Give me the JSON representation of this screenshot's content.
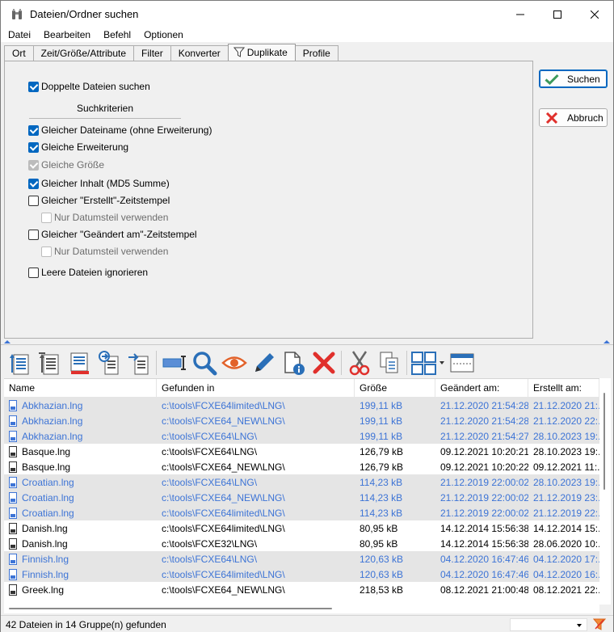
{
  "window": {
    "title": "Dateien/Ordner suchen"
  },
  "menu": [
    "Datei",
    "Bearbeiten",
    "Befehl",
    "Optionen"
  ],
  "tabs": [
    "Ort",
    "Zeit/Größe/Attribute",
    "Filter",
    "Konverter",
    "Duplikate",
    "Profile"
  ],
  "duplicates": {
    "find_duplicates": {
      "label": "Doppelte Dateien suchen",
      "checked": true
    },
    "criteria_heading": "Suchkriterien",
    "options": [
      {
        "label": "Gleicher Dateiname (ohne Erweiterung)",
        "checked": true,
        "disabled": false
      },
      {
        "label": "Gleiche Erweiterung",
        "checked": true,
        "disabled": false
      },
      {
        "label": "Gleiche Größe",
        "checked": true,
        "disabled": true
      },
      {
        "label": "Gleicher Inhalt (MD5 Summe)",
        "checked": true,
        "disabled": false
      },
      {
        "label": "Gleicher \"Erstellt\"-Zeitstempel",
        "checked": false,
        "disabled": false
      },
      {
        "label": "Nur Datumsteil verwenden",
        "checked": false,
        "disabled": true
      },
      {
        "label": "Gleicher \"Geändert am\"-Zeitstempel",
        "checked": false,
        "disabled": false
      },
      {
        "label": "Nur Datumsteil verwenden",
        "checked": false,
        "disabled": true
      },
      {
        "label": "Leere Dateien ignorieren",
        "checked": false,
        "disabled": false
      }
    ]
  },
  "buttons": {
    "search": "Suchen",
    "cancel": "Abbruch"
  },
  "results": {
    "columns": [
      "Name",
      "Gefunden in",
      "Größe",
      "Geändert am:",
      "Erstellt am:"
    ],
    "rows": [
      {
        "name": "Abkhazian.lng",
        "path": "c:\\tools\\FCXE64limited\\LNG\\",
        "size": "199,11 kB",
        "modified": "21.12.2020 21:54:28",
        "created": "21.12.2020 21:...",
        "group": true
      },
      {
        "name": "Abkhazian.lng",
        "path": "c:\\tools\\FCXE64_NEW\\LNG\\",
        "size": "199,11 kB",
        "modified": "21.12.2020 21:54:28",
        "created": "21.12.2020 22:...",
        "group": true
      },
      {
        "name": "Abkhazian.lng",
        "path": "c:\\tools\\FCXE64\\LNG\\",
        "size": "199,11 kB",
        "modified": "21.12.2020 21:54:27",
        "created": "28.10.2023 19:...",
        "group": true
      },
      {
        "name": "Basque.lng",
        "path": "c:\\tools\\FCXE64\\LNG\\",
        "size": "126,79 kB",
        "modified": "09.12.2021 10:20:21",
        "created": "28.10.2023 19:...",
        "group": false
      },
      {
        "name": "Basque.lng",
        "path": "c:\\tools\\FCXE64_NEW\\LNG\\",
        "size": "126,79 kB",
        "modified": "09.12.2021 10:20:22",
        "created": "09.12.2021 11:...",
        "group": false
      },
      {
        "name": "Croatian.lng",
        "path": "c:\\tools\\FCXE64\\LNG\\",
        "size": "114,23 kB",
        "modified": "21.12.2019 22:00:02",
        "created": "28.10.2023 19:...",
        "group": true
      },
      {
        "name": "Croatian.lng",
        "path": "c:\\tools\\FCXE64_NEW\\LNG\\",
        "size": "114,23 kB",
        "modified": "21.12.2019 22:00:02",
        "created": "21.12.2019 23:...",
        "group": true
      },
      {
        "name": "Croatian.lng",
        "path": "c:\\tools\\FCXE64limited\\LNG\\",
        "size": "114,23 kB",
        "modified": "21.12.2019 22:00:02",
        "created": "21.12.2019 22:...",
        "group": true
      },
      {
        "name": "Danish.lng",
        "path": "c:\\tools\\FCXE64limited\\LNG\\",
        "size": "80,95 kB",
        "modified": "14.12.2014 15:56:38",
        "created": "14.12.2014 15:...",
        "group": false
      },
      {
        "name": "Danish.lng",
        "path": "c:\\tools\\FCXE32\\LNG\\",
        "size": "80,95 kB",
        "modified": "14.12.2014 15:56:38",
        "created": "28.06.2020 10:...",
        "group": false
      },
      {
        "name": "Finnish.lng",
        "path": "c:\\tools\\FCXE64\\LNG\\",
        "size": "120,63 kB",
        "modified": "04.12.2020 16:47:46",
        "created": "04.12.2020 17:...",
        "group": true
      },
      {
        "name": "Finnish.lng",
        "path": "c:\\tools\\FCXE64limited\\LNG\\",
        "size": "120,63 kB",
        "modified": "04.12.2020 16:47:46",
        "created": "04.12.2020 16:...",
        "group": true
      },
      {
        "name": "Greek.lng",
        "path": "c:\\tools\\FCXE64_NEW\\LNG\\",
        "size": "218,53 kB",
        "modified": "08.12.2021 21:00:48",
        "created": "08.12.2021 22:...",
        "group": false
      }
    ]
  },
  "status": {
    "text": "42 Dateien in 14 Gruppe(n) gefunden"
  },
  "colors": {
    "accent": "#0067c0",
    "group_text": "#3d74d6",
    "group_bg": "#e5e5e5",
    "cancel_red": "#e0302c",
    "ok_green": "#3c9a5c"
  }
}
